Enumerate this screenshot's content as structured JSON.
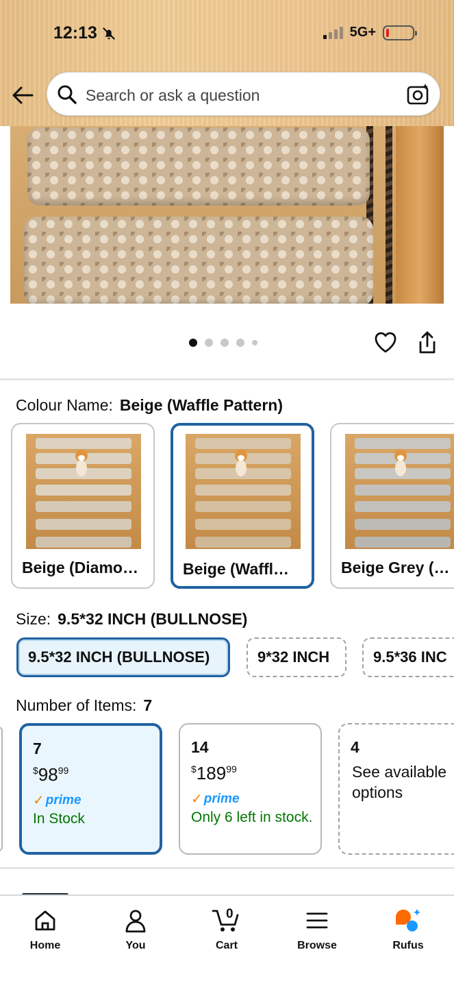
{
  "status_bar": {
    "time": "12:13",
    "network": "5G+"
  },
  "search": {
    "placeholder": "Search or ask a question"
  },
  "gallery": {
    "page_count": 5,
    "active_page": 1
  },
  "colour": {
    "label": "Colour Name:",
    "selected": "Beige (Waffle Pattern)",
    "options": [
      {
        "label": "Beige (Diamo…"
      },
      {
        "label": "Beige (Waffl…"
      },
      {
        "label": "Beige Grey (…"
      }
    ]
  },
  "size": {
    "label": "Size:",
    "selected": "9.5*32 INCH (BULLNOSE)",
    "options": [
      {
        "label": "9.5*32 INCH (BULLNOSE)"
      },
      {
        "label": "9*32 INCH"
      },
      {
        "label": "9.5*36 INC"
      }
    ]
  },
  "quantity": {
    "label": "Number of Items:",
    "selected": "7",
    "options": [
      {
        "count": "7",
        "currency": "$",
        "dollars": "98",
        "cents": "99",
        "prime": "prime",
        "stock": "In Stock"
      },
      {
        "count": "14",
        "currency": "$",
        "dollars": "189",
        "cents": "99",
        "prime": "prime",
        "stock": "Only 6 left in stock."
      },
      {
        "count": "4",
        "see": "See available options"
      }
    ]
  },
  "cart": {
    "count": "0"
  },
  "bottom_nav": {
    "home": "Home",
    "you": "You",
    "cart": "Cart",
    "browse": "Browse",
    "rufus": "Rufus"
  },
  "colors": {
    "accent_blue": "#2162a1",
    "prime_blue": "#1a98ff",
    "stock_green": "#007600",
    "header_tan": "#eec690",
    "rufus_orange": "#ff6a00"
  }
}
